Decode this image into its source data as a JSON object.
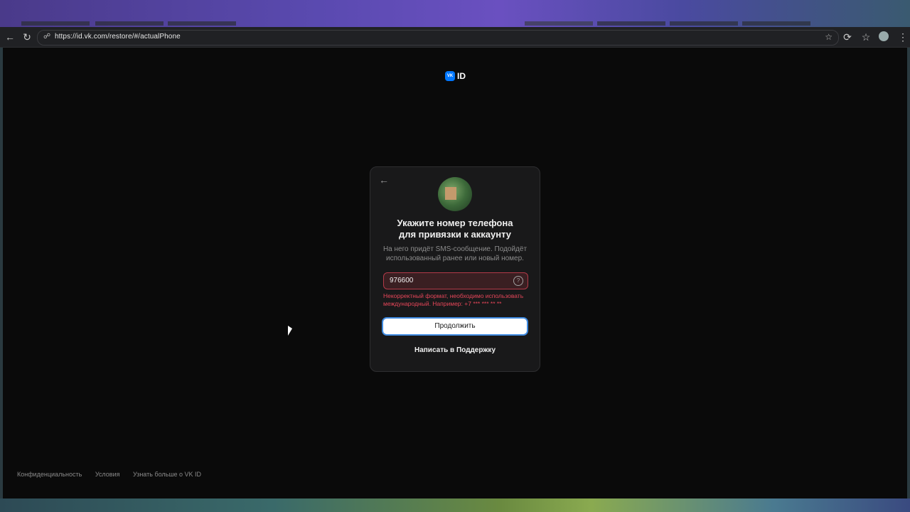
{
  "browser": {
    "url": "https://id.vk.com/restore/#/actualPhone"
  },
  "logo": {
    "mark": "VK",
    "text": "ID"
  },
  "card": {
    "title_line1": "Укажите номер телефона",
    "title_line2": "для привязки к аккаунту",
    "subtitle_line1": "На него придёт SMS-сообщение. Подойдёт",
    "subtitle_line2": "использованный ранее или новый номер.",
    "phone_value": "976600",
    "error_line1": "Некорректный формат, необходимо использовать",
    "error_line2": "международный. Например: +7 *** *** ** **",
    "continue_label": "Продолжить",
    "support_label": "Написать в Поддержку"
  },
  "footer": {
    "privacy": "Конфиденциальность",
    "terms": "Условия",
    "about": "Узнать больше о VK ID"
  },
  "icons": {
    "back": "arrow-left-icon",
    "reload": "reload-icon",
    "lock": "lock-icon",
    "star": "star-icon",
    "help": "question-icon"
  }
}
